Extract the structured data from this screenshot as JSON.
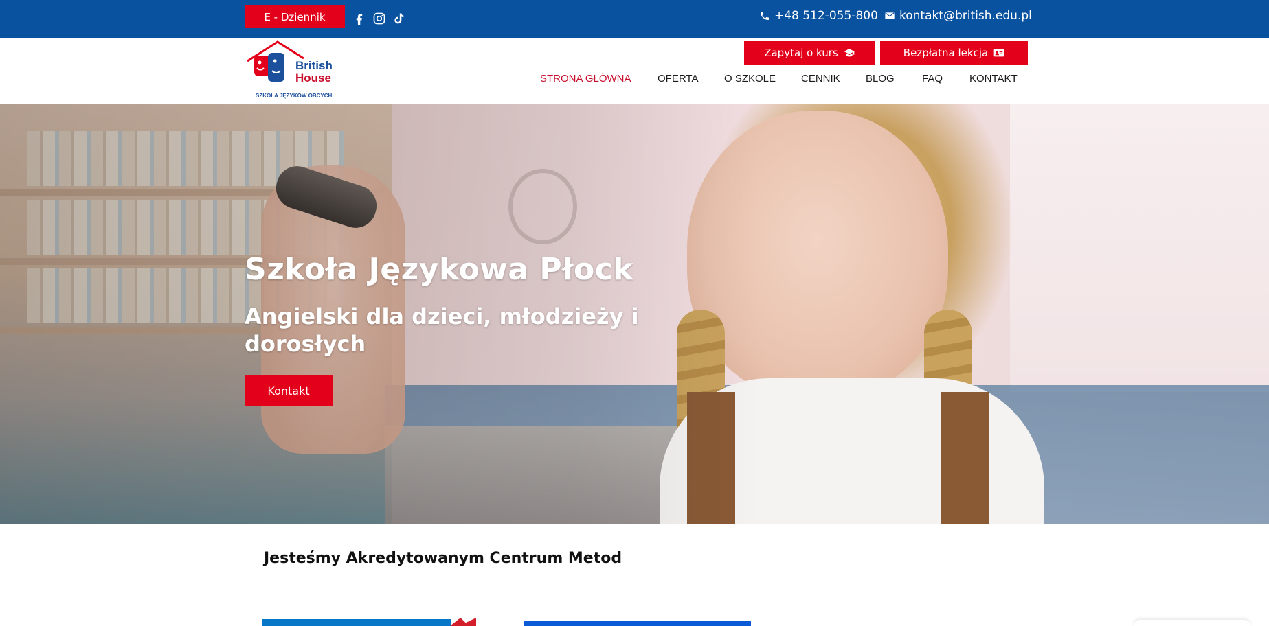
{
  "topbar": {
    "ediary_label": "E - Dziennik",
    "phone": "+48 512-055-800",
    "email": "kontakt@british.edu.pl",
    "social": [
      "facebook-icon",
      "instagram-icon",
      "tiktok-icon"
    ]
  },
  "logo": {
    "line1": "British",
    "line2": "House",
    "tagline": "SZKOŁA JĘZYKÓW OBCYCH"
  },
  "header": {
    "cta_ask": "Zapytaj o kurs",
    "cta_free": "Bezpłatna lekcja"
  },
  "nav": {
    "items": [
      "STRONA GŁÓWNA",
      "OFERTA",
      "O SZKOLE",
      "CENNIK",
      "BLOG",
      "FAQ",
      "KONTAKT"
    ],
    "active": "STRONA GŁÓWNA"
  },
  "hero": {
    "title": "Szkoła Językowa Płock",
    "subtitle": "Angielski dla dzieci, młodzieży i dorosłych",
    "button": "Kontakt"
  },
  "section": {
    "title": "Jesteśmy Akredytowanym Centrum Metod"
  },
  "colors": {
    "topbar": "#0852a0",
    "accent_red": "#e3001b",
    "nav_active": "#c8102e",
    "logo_blue": "#1c4f9c"
  }
}
